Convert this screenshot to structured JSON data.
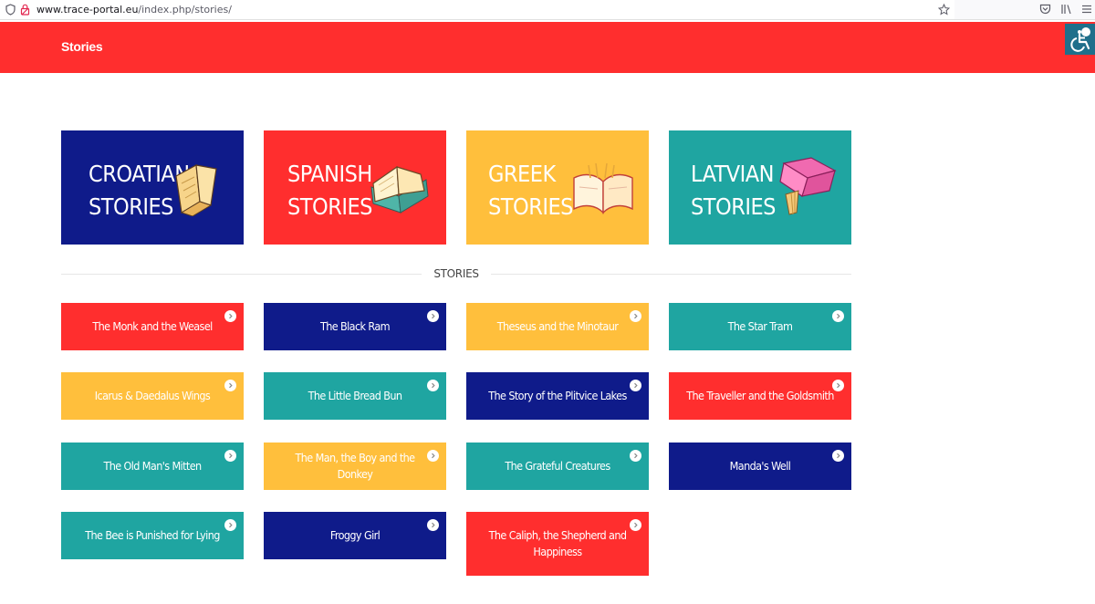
{
  "browser": {
    "url_domain": "www.trace-portal.eu",
    "url_path": "/index.php/stories/"
  },
  "header": {
    "title": "Stories"
  },
  "categories": [
    {
      "line1": "CROATIAN",
      "line2": "STORIES",
      "color": "#0f1b8a"
    },
    {
      "line1": "SPANISH",
      "line2": "STORIES",
      "color": "#ff2e2e"
    },
    {
      "line1": "GREEK",
      "line2": "STORIES",
      "color": "#ffbf3c"
    },
    {
      "line1": "LATVIAN",
      "line2": "STORIES",
      "color": "#1fa5a1"
    }
  ],
  "section_label": "STORIES",
  "stories": [
    {
      "title": "The Monk and the Weasel",
      "color": "#ff2e2e"
    },
    {
      "title": "The Black Ram",
      "color": "#0f1b8a"
    },
    {
      "title": "Theseus and the Minotaur",
      "color": "#ffbf3c"
    },
    {
      "title": "The Star Tram",
      "color": "#1fa5a1"
    },
    {
      "title": "Icarus & Daedalus Wings",
      "color": "#ffbf3c"
    },
    {
      "title": "The Little Bread Bun",
      "color": "#1fa5a1"
    },
    {
      "title": "The Story of the Plitvice Lakes",
      "color": "#0f1b8a"
    },
    {
      "title": "The Traveller and the Goldsmith",
      "color": "#ff2e2e"
    },
    {
      "title": "The Old Man's Mitten",
      "color": "#1fa5a1"
    },
    {
      "title": "The Man, the Boy and the Donkey",
      "color": "#ffbf3c"
    },
    {
      "title": "The Grateful Creatures",
      "color": "#1fa5a1"
    },
    {
      "title": "Manda's Well",
      "color": "#0f1b8a"
    },
    {
      "title": "The Bee is Punished for Lying",
      "color": "#1fa5a1"
    },
    {
      "title": "Froggy Girl",
      "color": "#0f1b8a"
    },
    {
      "title": "The Caliph, the Shepherd and Happiness",
      "color": "#ff2e2e"
    }
  ]
}
